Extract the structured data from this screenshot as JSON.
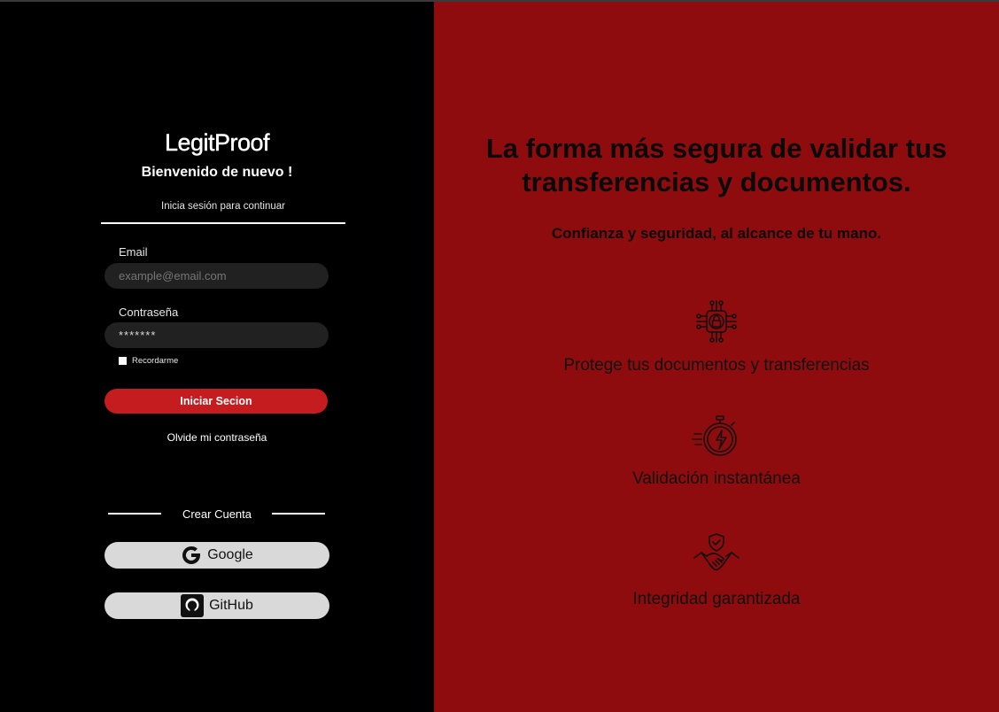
{
  "login": {
    "brand": "LegitProof",
    "welcome": "Bienvenido de nuevo !",
    "subtitle": "Inicia sesión para continuar",
    "email_label": "Email",
    "email_placeholder": "example@email.com",
    "password_label": "Contraseña",
    "password_value": "*******",
    "remember_label": "Recordarme",
    "submit_label": "Iniciar Secion",
    "forgot_label": "Olvide mi contraseña",
    "create_account_label": "Crear Cuenta",
    "google_label": "Google",
    "github_label": "GitHub"
  },
  "hero": {
    "headline_line1": "La forma más segura de validar tus",
    "headline_line2": "transferencias y documentos.",
    "tagline": "Confianza y seguridad, al alcance de tu mano.",
    "features": [
      {
        "icon": "circuit-lock-icon",
        "text": "Protege tus documentos y transferencias"
      },
      {
        "icon": "stopwatch-bolt-icon",
        "text": "Validación instantánea"
      },
      {
        "icon": "handshake-shield-icon",
        "text": "Integridad garantizada"
      }
    ]
  },
  "colors": {
    "left_background": "#000000",
    "right_background": "#8e0c0e",
    "primary_button": "#c41c1f",
    "input_background": "#212121",
    "social_button": "#d9d9d9"
  }
}
